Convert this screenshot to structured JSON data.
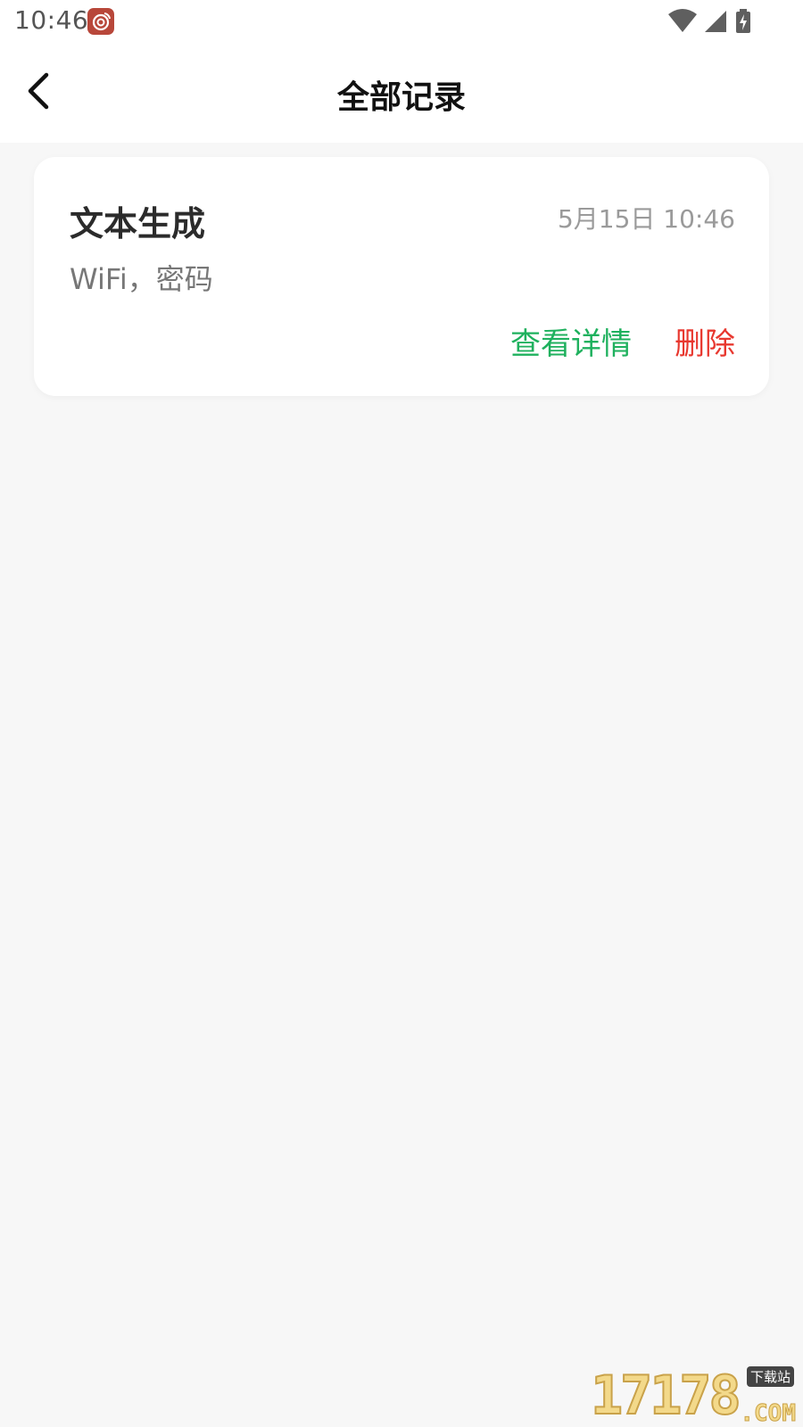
{
  "status_bar": {
    "time": "10:46",
    "notification_icon": "weibo-icon",
    "icons": [
      "wifi-icon",
      "cellular-signal-icon",
      "battery-charging-icon"
    ]
  },
  "header": {
    "back_icon": "back-arrow-icon",
    "title": "全部记录"
  },
  "records": [
    {
      "title": "文本生成",
      "time": "5月15日 10:46",
      "content": "WiFi，密码",
      "detail_label": "查看详情",
      "delete_label": "删除"
    }
  ],
  "watermark": {
    "number": "17178",
    "tag": "下载站",
    "suffix": ".COM"
  },
  "colors": {
    "background": "#f7f7f7",
    "card": "#ffffff",
    "detail": "#1fb15e",
    "delete": "#e8382f",
    "secondary_text": "#9a9a9a"
  }
}
